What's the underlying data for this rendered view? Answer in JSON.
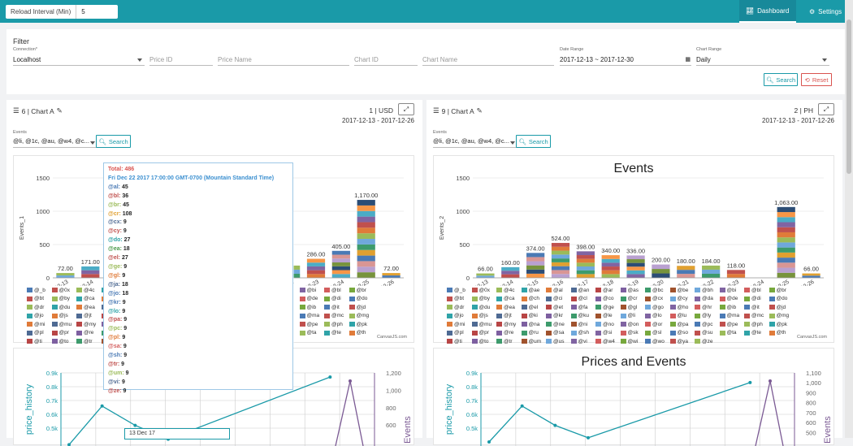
{
  "header": {
    "reload_label": "Reload Interval (Min)",
    "reload_value": "5",
    "dashboard": "Dashboard",
    "settings": "Settings"
  },
  "filter": {
    "title": "Filter",
    "connection_caption": "Connection*",
    "connection": "Localhost",
    "price_id": "Price ID",
    "price_name": "Price Name",
    "chart_id": "Chart ID",
    "chart_name": "Chart Name",
    "date_caption": "Date Range",
    "date_range": "2017-12-13 ~ 2017-12-30",
    "chart_range_caption": "Chart Range",
    "chart_range": "Daily",
    "search": "Search",
    "reset": "Reset"
  },
  "panels": [
    {
      "title": "6 | Chart A",
      "right": "1 | USD",
      "date": "2017-12-13 - 2017-12-26",
      "events_caption": "Events",
      "events_value": "@li, @1c, @au, @w4, @c...",
      "search": "Search"
    },
    {
      "title": "9 | Chart A",
      "right": "2 | PH",
      "date": "2017-12-13 - 2017-12-26",
      "events_caption": "Events",
      "events_value": "@li, @1c, @au, @w4, @c...",
      "search": "Search"
    }
  ],
  "chart_titles": {
    "events": "Events",
    "prices": "Prices and Events",
    "credit": "CanvasJS.com"
  },
  "chart_data": [
    {
      "type": "bar",
      "title": "Events",
      "ylabel": "Events_1",
      "ylim": [
        0,
        1500
      ],
      "yticks": [
        0,
        500,
        1000,
        1500
      ],
      "categories": [
        "2017-12-13",
        "2017-12-14",
        "2017-12-15",
        "2017-12-16",
        "2017-12-17",
        "2017-12-18",
        "2017-12-19",
        "2017-12-20",
        "2017-12-21",
        "2017-12-22",
        "2017-12-23",
        "2017-12-24",
        "2017-12-25",
        "2017-12-26"
      ],
      "values": [
        72,
        171,
        374,
        486,
        400,
        340,
        336,
        200,
        180,
        184,
        286,
        405,
        1170,
        72
      ],
      "labels": [
        "72.00",
        "171.00",
        "",
        "",
        "",
        "",
        "",
        "",
        "",
        "",
        "286.00",
        "405.00",
        "1,170.00",
        "72.00"
      ]
    },
    {
      "type": "bar",
      "title": "Events",
      "ylabel": "Events_2",
      "ylim": [
        0,
        1500
      ],
      "yticks": [
        0,
        500,
        1000,
        1500
      ],
      "categories": [
        "2017-12-13",
        "2017-12-14",
        "2017-12-15",
        "2017-12-16",
        "2017-12-17",
        "2017-12-18",
        "2017-12-19",
        "2017-12-20",
        "2017-12-21",
        "2017-12-22",
        "2017-12-23",
        "2017-12-24",
        "2017-12-25",
        "2017-12-26"
      ],
      "values": [
        66,
        160,
        374,
        524,
        398,
        340,
        336,
        200,
        180,
        184,
        118,
        0,
        1063,
        66
      ],
      "labels": [
        "66.00",
        "160.00",
        "374.00",
        "524.00",
        "398.00",
        "340.00",
        "336.00",
        "200.00",
        "180.00",
        "184.00",
        "118.00",
        "",
        "1,063.00",
        "66.00"
      ]
    },
    {
      "type": "line",
      "title": "Prices and Events",
      "ylabel": "price_history",
      "y2label": "Events",
      "yticks": [
        "0.9k",
        "0.8k",
        "0.7k",
        "0.6k",
        "0.5k"
      ],
      "y2ticks": [
        "1,200",
        "1,000",
        "800",
        "600"
      ],
      "series": [
        {
          "values": [
            380,
            660,
            520,
            420,
            null,
            null,
            null,
            null,
            870,
            null
          ]
        },
        {
          "values": [
            null,
            null,
            null,
            null,
            null,
            null,
            null,
            null,
            null,
            1170
          ]
        }
      ]
    },
    {
      "type": "line",
      "title": "Prices and Events",
      "ylabel": "price_history",
      "y2label": "Events",
      "yticks": [
        "0.9k",
        "0.8k",
        "0.7k",
        "0.6k",
        "0.5k"
      ],
      "y2ticks": [
        "1,100",
        "1,000",
        "900",
        "800",
        "700",
        "600",
        "500"
      ],
      "series": [
        {
          "values": [
            400,
            660,
            520,
            430,
            null,
            null,
            null,
            null,
            830,
            null
          ]
        },
        {
          "values": [
            null,
            null,
            null,
            null,
            null,
            null,
            null,
            null,
            null,
            1063
          ]
        }
      ]
    }
  ],
  "legend": [
    "@_b",
    "@0x",
    "@4c",
    "@ae",
    "@al",
    "@an",
    "@ar",
    "@as",
    "@bc",
    "@be",
    "@bh",
    "@bi",
    "@bl",
    "@br",
    "@bt",
    "@by",
    "@ca",
    "@ch",
    "@ci",
    "@cl",
    "@co",
    "@cr",
    "@cx",
    "@cy",
    "@da",
    "@de",
    "@di",
    "@do",
    "@dr",
    "@du",
    "@ea",
    "@el",
    "@et",
    "@fa",
    "@ge",
    "@gl",
    "@go",
    "@ho",
    "@hr",
    "@ib",
    "@it",
    "@jd",
    "@jo",
    "@js",
    "@jt",
    "@ki",
    "@kr",
    "@ku",
    "@le",
    "@li",
    "@lo",
    "@lu",
    "@ly",
    "@ma",
    "@mc",
    "@mg",
    "@mi",
    "@mu",
    "@my",
    "@na",
    "@ne",
    "@ni",
    "@no",
    "@on",
    "@or",
    "@pa",
    "@pc",
    "@pe",
    "@ph",
    "@pk",
    "@pl",
    "@pr",
    "@re",
    "@ru",
    "@sa",
    "@sh",
    "@si",
    "@sk",
    "@sl",
    "@so",
    "@su",
    "@ta",
    "@te",
    "@th",
    "@ti",
    "@to",
    "@tr",
    "@um",
    "@us",
    "@vi",
    "@w4",
    "@wi",
    "@wo",
    "@ya",
    "@ze"
  ],
  "legend_colors": [
    "#4a7ab5",
    "#c0504d",
    "#9bbb59",
    "#2fa3a8",
    "#e07b39",
    "#4e6a93",
    "#b84545",
    "#7d5fa0",
    "#3d9b6c",
    "#a0522d",
    "#6fa8dc",
    "#8064a2",
    "#d35d5d",
    "#77a83d"
  ],
  "tooltip": {
    "total": "Total: 486",
    "date": "Fri Dec 22 2017 17:00:00 GMT-0700 (Mountain Standard Time)",
    "rows": [
      {
        "k": "@al:",
        "v": "45",
        "c": "#4a7ab5"
      },
      {
        "k": "@bl:",
        "v": "36",
        "c": "#c0504d"
      },
      {
        "k": "@br:",
        "v": "45",
        "c": "#9bbb59"
      },
      {
        "k": "@cr:",
        "v": "108",
        "c": "#e0a030"
      },
      {
        "k": "@cx:",
        "v": "9",
        "c": "#4e6a93"
      },
      {
        "k": "@cy:",
        "v": "9",
        "c": "#c0504d"
      },
      {
        "k": "@do:",
        "v": "27",
        "c": "#2fa3a8"
      },
      {
        "k": "@ea:",
        "v": "18",
        "c": "#4a9a4a"
      },
      {
        "k": "@el:",
        "v": "27",
        "c": "#c0504d"
      },
      {
        "k": "@ge:",
        "v": "9",
        "c": "#9bbb59"
      },
      {
        "k": "@gl:",
        "v": "9",
        "c": "#e07b39"
      },
      {
        "k": "@ja:",
        "v": "18",
        "c": "#4e6a93"
      },
      {
        "k": "@jo:",
        "v": "18",
        "c": "#4a7ab5"
      },
      {
        "k": "@kr:",
        "v": "9",
        "c": "#4a7ab5"
      },
      {
        "k": "@lo:",
        "v": "9",
        "c": "#2fa3a8"
      },
      {
        "k": "@pa:",
        "v": "9",
        "c": "#c0504d"
      },
      {
        "k": "@pc:",
        "v": "9",
        "c": "#9bbb59"
      },
      {
        "k": "@pl:",
        "v": "9",
        "c": "#e07b39"
      },
      {
        "k": "@sa:",
        "v": "9",
        "c": "#d35d5d"
      },
      {
        "k": "@sh:",
        "v": "9",
        "c": "#4a7ab5"
      },
      {
        "k": "@tr:",
        "v": "9",
        "c": "#c0504d"
      },
      {
        "k": "@um:",
        "v": "9",
        "c": "#9bbb59"
      },
      {
        "k": "@vi:",
        "v": "9",
        "c": "#4e6a93"
      },
      {
        "k": "@ze:",
        "v": "9",
        "c": "#c0504d"
      }
    ]
  },
  "date_tooltip": "13 Dec 17"
}
